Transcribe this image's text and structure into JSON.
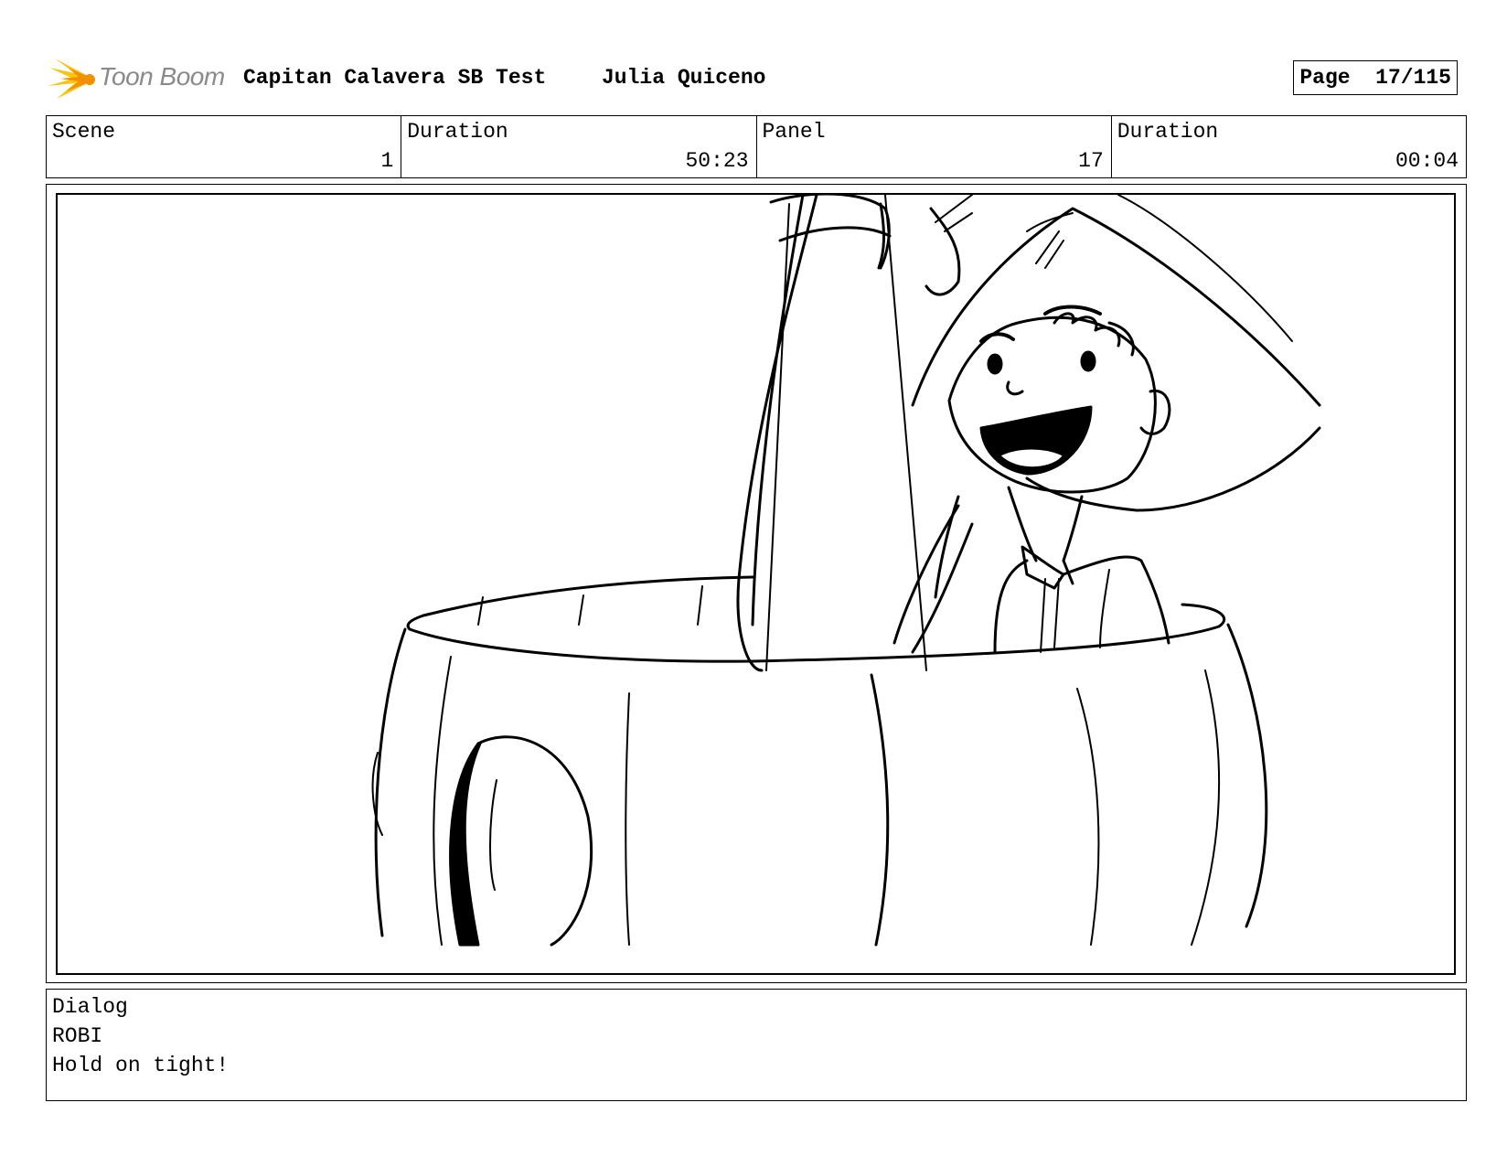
{
  "header": {
    "logo_text": "Toon Boom",
    "project_title": "Capitan Calavera SB Test",
    "author": "Julia Quiceno",
    "page_label": "Page",
    "page_value": "17/115"
  },
  "info": {
    "scene_label": "Scene",
    "scene_value": "1",
    "duration_label": "Duration",
    "duration_value": "50:23",
    "panel_label": "Panel",
    "panel_value": "17",
    "panel_duration_label": "Duration",
    "panel_duration_value": "00:04"
  },
  "dialog": {
    "label": "Dialog",
    "character": "ROBI",
    "line": "Hold on tight!"
  },
  "icons": {
    "logo": "toon-boom-starburst-icon"
  },
  "colors": {
    "logo_yellow": "#f5c518",
    "logo_orange": "#f29100",
    "logo_text": "#8a8a8a"
  }
}
